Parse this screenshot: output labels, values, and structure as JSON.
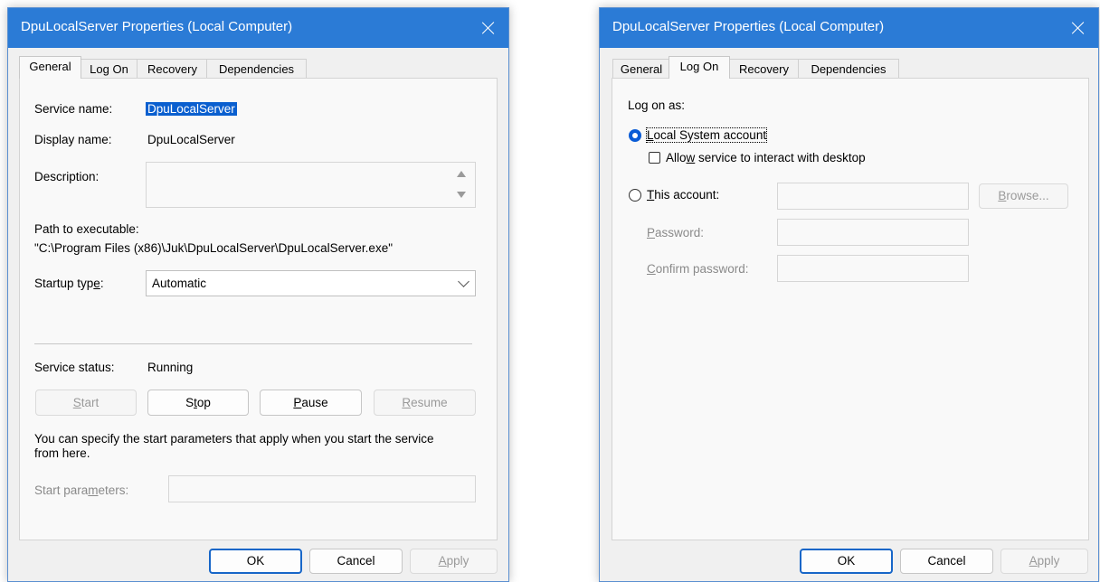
{
  "dialog1": {
    "title": "DpuLocalServer Properties (Local Computer)",
    "tabs": [
      "General",
      "Log On",
      "Recovery",
      "Dependencies"
    ],
    "active_tab": "General",
    "service_name_label": "Service name:",
    "service_name_value": "DpuLocalServer",
    "display_name_label": "Display name:",
    "display_name_value": "DpuLocalServer",
    "description_label": "Description:",
    "description_value": "",
    "path_label": "Path to executable:",
    "path_value": "\"C:\\Program Files (x86)\\Juk\\DpuLocalServer\\DpuLocalServer.exe\"",
    "startup_type_label": {
      "pre": "Startup typ",
      "accel": "e",
      "post": ":"
    },
    "startup_type_value": "Automatic",
    "service_status_label": "Service status:",
    "service_status_value": "Running",
    "buttons": {
      "start": {
        "pre": "",
        "accel": "S",
        "post": "tart"
      },
      "stop": {
        "pre": "S",
        "accel": "t",
        "post": "op"
      },
      "pause": {
        "pre": "",
        "accel": "P",
        "post": "ause"
      },
      "resume": {
        "pre": "",
        "accel": "R",
        "post": "esume"
      }
    },
    "hint_line1": "You can specify the start parameters that apply when you start the service",
    "hint_line2": "from here.",
    "start_params_label": {
      "pre": "Start para",
      "accel": "m",
      "post": "eters:"
    },
    "ok": "OK",
    "cancel": "Cancel",
    "apply": {
      "pre": "",
      "accel": "A",
      "post": "pply"
    }
  },
  "dialog2": {
    "title": "DpuLocalServer Properties (Local Computer)",
    "tabs": [
      "General",
      "Log On",
      "Recovery",
      "Dependencies"
    ],
    "active_tab": "Log On",
    "log_on_as": "Log on as:",
    "local_system": {
      "pre": "",
      "accel": "L",
      "post": "ocal System account"
    },
    "allow_interact": {
      "pre": "Allo",
      "accel": "w",
      "post": " service to interact with desktop"
    },
    "this_account": {
      "pre": "",
      "accel": "T",
      "post": "his account:"
    },
    "browse": {
      "pre": "",
      "accel": "B",
      "post": "rowse..."
    },
    "password": {
      "pre": "",
      "accel": "P",
      "post": "assword:"
    },
    "confirm_password": {
      "pre": "",
      "accel": "C",
      "post": "onfirm password:"
    },
    "ok": "OK",
    "cancel": "Cancel",
    "apply": {
      "pre": "",
      "accel": "A",
      "post": "pply"
    }
  },
  "colors": {
    "titlebar": "#2b7bd6",
    "selection": "#0a5fcf",
    "radio_selected": "#0b5cd6"
  }
}
